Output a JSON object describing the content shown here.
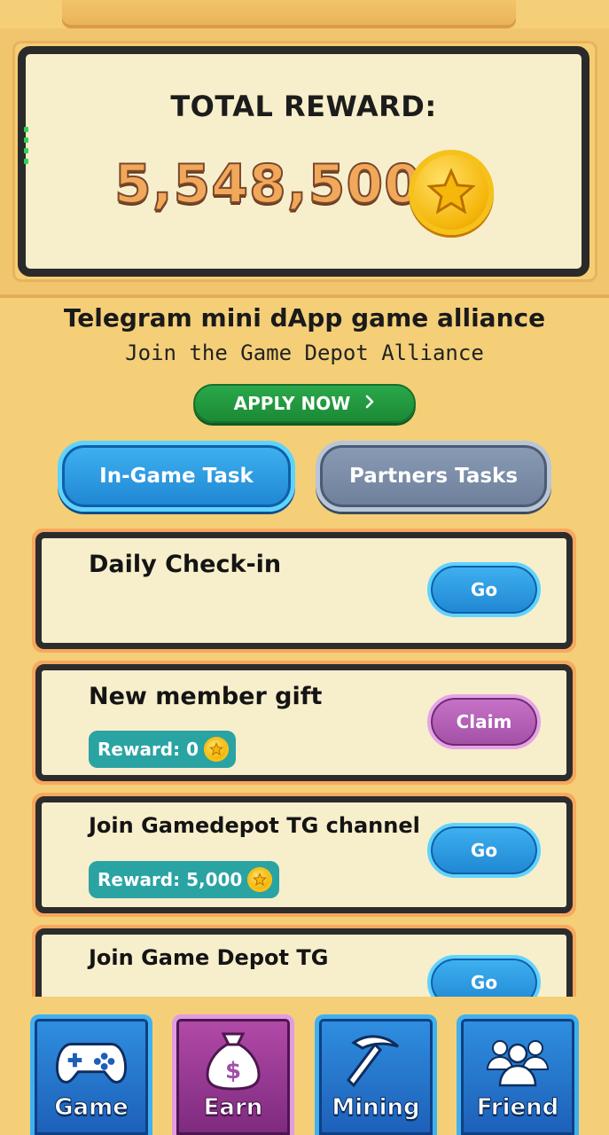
{
  "header": {
    "total_reward_label": "TOTAL REWARD:",
    "total_reward_value": "5,548,500",
    "coin_icon": "star-coin-icon"
  },
  "alliance": {
    "title": "Telegram mini dApp game alliance",
    "subtitle": "Join the Game Depot Alliance",
    "apply_label": "APPLY NOW",
    "apply_icon": "chevron-right-icon"
  },
  "tabs": [
    {
      "label": "In-Game Task",
      "active": true
    },
    {
      "label": "Partners Tasks",
      "active": false
    }
  ],
  "tasks": [
    {
      "title": "Daily Check-in",
      "reward": "",
      "button": "Go",
      "button_style": "blue"
    },
    {
      "title": "New member gift",
      "reward": "Reward: 0",
      "button": "Claim",
      "button_style": "purple"
    },
    {
      "title": "Join Gamedepot TG channel",
      "reward": "Reward: 5,000",
      "button": "Go",
      "button_style": "blue"
    },
    {
      "title": "Join Game Depot TG",
      "reward": "",
      "button": "Go",
      "button_style": "blue"
    }
  ],
  "nav": [
    {
      "label": "Game",
      "icon": "gamepad-icon",
      "active": false
    },
    {
      "label": "Earn",
      "icon": "money-bag-icon",
      "active": true
    },
    {
      "label": "Mining",
      "icon": "pickaxe-icon",
      "active": false
    },
    {
      "label": "Friend",
      "icon": "friends-icon",
      "active": false
    }
  ],
  "colors": {
    "background": "#f4cf78",
    "accent_blue": "#1f86d3",
    "accent_green": "#1b8a35",
    "accent_purple": "#a24fa6",
    "reward_teal": "#2aa3a3"
  }
}
